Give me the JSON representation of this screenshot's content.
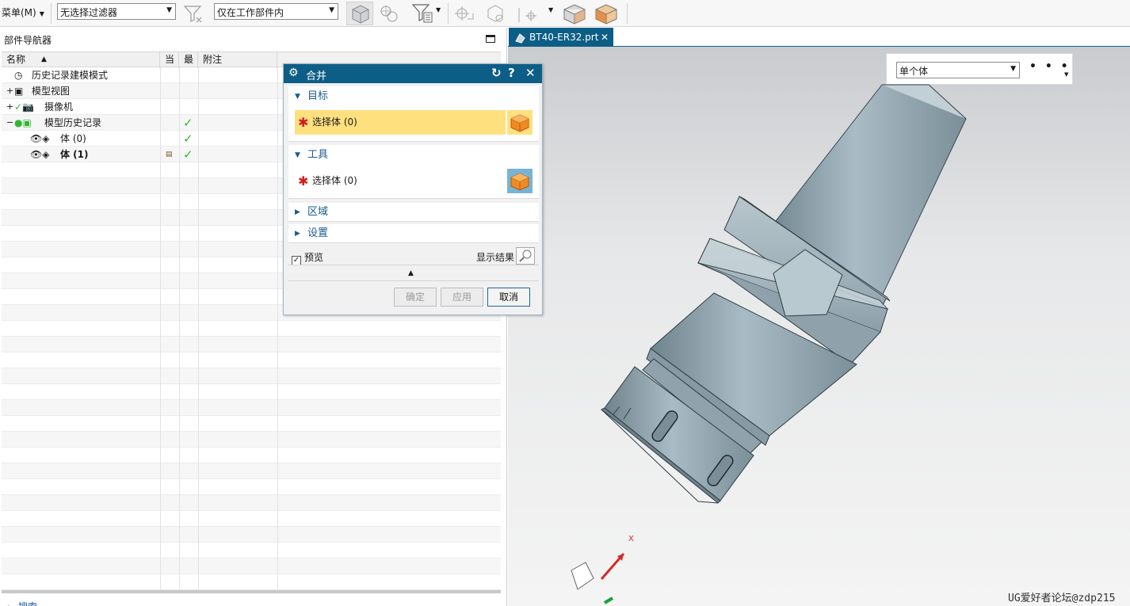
{
  "toolbar": {
    "menu_label": "菜单(M)",
    "filter_combo": "无选择过滤器",
    "scope_combo": "仅在工作部件内"
  },
  "navigator": {
    "title": "部件导航器",
    "columns": [
      "名称",
      "当",
      "最",
      "附注"
    ],
    "rows": [
      {
        "label": "历史记录建模模式",
        "bold": false,
        "current": false,
        "latest": false
      },
      {
        "label": "模型视图",
        "bold": false,
        "current": false,
        "latest": false
      },
      {
        "label": "摄像机",
        "bold": false,
        "current": false,
        "latest": false
      },
      {
        "label": "模型历史记录",
        "bold": false,
        "current": false,
        "latest": true
      },
      {
        "label": "体 (0)",
        "bold": false,
        "current": false,
        "latest": true
      },
      {
        "label": "体 (1)",
        "bold": true,
        "current": true,
        "latest": true
      }
    ],
    "search_label": "搜索"
  },
  "viewport": {
    "tab_label": "BT40-ER32.prt",
    "selection_scope": "单个体",
    "more_label": "• • •",
    "axis_x_label": "X"
  },
  "dialog": {
    "title": "合并",
    "target_group": "目标",
    "target_select": "选择体 (0)",
    "tool_group": "工具",
    "tool_select": "选择体 (0)",
    "region_group": "区域",
    "settings_group": "设置",
    "preview_label": "预览",
    "preview_checked": true,
    "show_result_label": "显示结果",
    "ok_label": "确定",
    "apply_label": "应用",
    "cancel_label": "取消"
  },
  "watermark": "UG爱好者论坛@zdp215",
  "colors": {
    "title_bar": "#0d5e86",
    "active_select": "#ffe07f",
    "check_green": "#2eb82e",
    "required_star": "#d01f1f"
  }
}
